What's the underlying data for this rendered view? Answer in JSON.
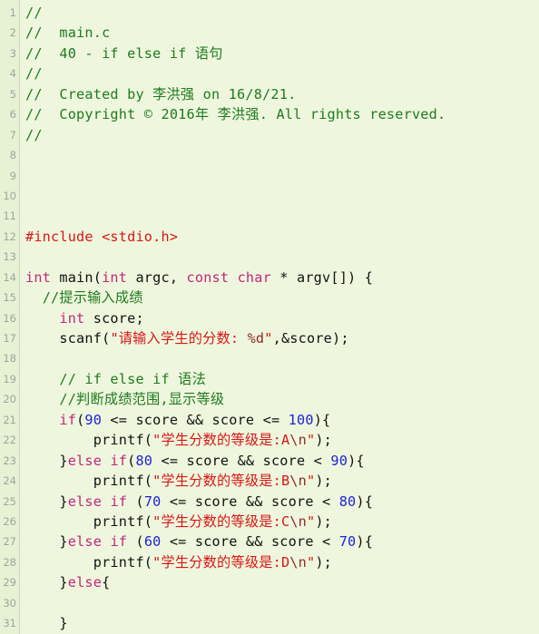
{
  "editor": {
    "name": "source-code-editor",
    "language": "c",
    "file_name": "main.c",
    "background_color": "#eef7dd",
    "gutter_color": "#e7f2d5",
    "colors": {
      "comment": "#1f7a1f",
      "keyword": "#c4267c",
      "number": "#1c23d6",
      "string": "#d81616",
      "escape": "#8f2a2a",
      "plain": "#111111",
      "line_number": "#9aa79a"
    },
    "first_visible_line": 1,
    "last_visible_line": 31
  },
  "line_numbers": [
    "1",
    "2",
    "3",
    "4",
    "5",
    "6",
    "7",
    "8",
    "9",
    "10",
    "11",
    "12",
    "13",
    "14",
    "15",
    "16",
    "17",
    "18",
    "19",
    "20",
    "21",
    "22",
    "23",
    "24",
    "25",
    "26",
    "27",
    "28",
    "29",
    "30",
    "31"
  ],
  "lines": [
    {
      "n": 1,
      "text": "//"
    },
    {
      "n": 2,
      "text": "//  main.c"
    },
    {
      "n": 3,
      "text": "//  40 - if else if 语句"
    },
    {
      "n": 4,
      "text": "//"
    },
    {
      "n": 5,
      "text": "//  Created by 李洪强 on 16/8/21."
    },
    {
      "n": 6,
      "text": "//  Copyright © 2016年 李洪强. All rights reserved."
    },
    {
      "n": 7,
      "text": "//"
    },
    {
      "n": 8,
      "text": ""
    },
    {
      "n": 9,
      "text": ""
    },
    {
      "n": 10,
      "text": ""
    },
    {
      "n": 11,
      "text": ""
    },
    {
      "n": 12,
      "text": "#include <stdio.h>"
    },
    {
      "n": 13,
      "text": ""
    },
    {
      "n": 14,
      "text": "int main(int argc, const char * argv[]) {"
    },
    {
      "n": 15,
      "text": "  //提示输入成绩"
    },
    {
      "n": 16,
      "text": "    int score;"
    },
    {
      "n": 17,
      "text": "    scanf(\"请输入学生的分数: %d\",&score);"
    },
    {
      "n": 18,
      "text": ""
    },
    {
      "n": 19,
      "text": "    // if else if 语法"
    },
    {
      "n": 20,
      "text": "    //判断成绩范围,显示等级"
    },
    {
      "n": 21,
      "text": "    if(90 <= score && score <= 100){"
    },
    {
      "n": 22,
      "text": "        printf(\"学生分数的等级是:A\\n\");"
    },
    {
      "n": 23,
      "text": "    }else if(80 <= score && score < 90){"
    },
    {
      "n": 24,
      "text": "        printf(\"学生分数的等级是:B\\n\");"
    },
    {
      "n": 25,
      "text": "    }else if (70 <= score && score < 80){"
    },
    {
      "n": 26,
      "text": "        printf(\"学生分数的等级是:C\\n\");"
    },
    {
      "n": 27,
      "text": "    }else if (60 <= score && score < 70){"
    },
    {
      "n": 28,
      "text": "        printf(\"学生分数的等级是:D\\n\");"
    },
    {
      "n": 29,
      "text": "    }else{"
    },
    {
      "n": 30,
      "text": ""
    },
    {
      "n": 31,
      "text": "    }"
    }
  ],
  "tokens": [
    [
      {
        "c": "t-cmt",
        "v": "//"
      }
    ],
    [
      {
        "c": "t-cmt",
        "v": "//  main.c"
      }
    ],
    [
      {
        "c": "t-cmt",
        "v": "//  40 - if else if 语句"
      }
    ],
    [
      {
        "c": "t-cmt",
        "v": "//"
      }
    ],
    [
      {
        "c": "t-cmt",
        "v": "//  Created by 李洪强 on 16/8/21."
      }
    ],
    [
      {
        "c": "t-cmt",
        "v": "//  Copyright © 2016年 李洪强. All rights reserved."
      }
    ],
    [
      {
        "c": "t-cmt",
        "v": "//"
      }
    ],
    [],
    [],
    [],
    [],
    [
      {
        "c": "t-pre",
        "v": "#include"
      },
      {
        "c": "t-pln",
        "v": " "
      },
      {
        "c": "t-pre",
        "v": "<stdio.h>"
      }
    ],
    [],
    [
      {
        "c": "t-kw",
        "v": "int"
      },
      {
        "c": "t-pln",
        "v": " main("
      },
      {
        "c": "t-kw",
        "v": "int"
      },
      {
        "c": "t-pln",
        "v": " argc, "
      },
      {
        "c": "t-kw",
        "v": "const"
      },
      {
        "c": "t-pln",
        "v": " "
      },
      {
        "c": "t-kw",
        "v": "char"
      },
      {
        "c": "t-pln",
        "v": " * argv[]) {"
      }
    ],
    [
      {
        "c": "t-pln",
        "v": "  "
      },
      {
        "c": "t-cmt",
        "v": "//提示输入成绩"
      }
    ],
    [
      {
        "c": "t-pln",
        "v": "    "
      },
      {
        "c": "t-kw",
        "v": "int"
      },
      {
        "c": "t-pln",
        "v": " score;"
      }
    ],
    [
      {
        "c": "t-pln",
        "v": "    scanf("
      },
      {
        "c": "t-str",
        "v": "\"请输入学生的分数: "
      },
      {
        "c": "t-esc",
        "v": "%d"
      },
      {
        "c": "t-str",
        "v": "\""
      },
      {
        "c": "t-pln",
        "v": ",&score);"
      }
    ],
    [],
    [
      {
        "c": "t-pln",
        "v": "    "
      },
      {
        "c": "t-cmt",
        "v": "// if else if 语法"
      }
    ],
    [
      {
        "c": "t-pln",
        "v": "    "
      },
      {
        "c": "t-cmt",
        "v": "//判断成绩范围,显示等级"
      }
    ],
    [
      {
        "c": "t-pln",
        "v": "    "
      },
      {
        "c": "t-kw",
        "v": "if"
      },
      {
        "c": "t-pln",
        "v": "("
      },
      {
        "c": "t-num",
        "v": "90"
      },
      {
        "c": "t-pln",
        "v": " <= score && score <= "
      },
      {
        "c": "t-num",
        "v": "100"
      },
      {
        "c": "t-pln",
        "v": "){"
      }
    ],
    [
      {
        "c": "t-pln",
        "v": "        printf("
      },
      {
        "c": "t-str",
        "v": "\"学生分数的等级是:A"
      },
      {
        "c": "t-esc",
        "v": "\\n"
      },
      {
        "c": "t-str",
        "v": "\""
      },
      {
        "c": "t-pln",
        "v": ");"
      }
    ],
    [
      {
        "c": "t-pln",
        "v": "    }"
      },
      {
        "c": "t-kw",
        "v": "else"
      },
      {
        "c": "t-pln",
        "v": " "
      },
      {
        "c": "t-kw",
        "v": "if"
      },
      {
        "c": "t-pln",
        "v": "("
      },
      {
        "c": "t-num",
        "v": "80"
      },
      {
        "c": "t-pln",
        "v": " <= score && score < "
      },
      {
        "c": "t-num",
        "v": "90"
      },
      {
        "c": "t-pln",
        "v": "){"
      }
    ],
    [
      {
        "c": "t-pln",
        "v": "        printf("
      },
      {
        "c": "t-str",
        "v": "\"学生分数的等级是:B"
      },
      {
        "c": "t-esc",
        "v": "\\n"
      },
      {
        "c": "t-str",
        "v": "\""
      },
      {
        "c": "t-pln",
        "v": ");"
      }
    ],
    [
      {
        "c": "t-pln",
        "v": "    }"
      },
      {
        "c": "t-kw",
        "v": "else"
      },
      {
        "c": "t-pln",
        "v": " "
      },
      {
        "c": "t-kw",
        "v": "if"
      },
      {
        "c": "t-pln",
        "v": " ("
      },
      {
        "c": "t-num",
        "v": "70"
      },
      {
        "c": "t-pln",
        "v": " <= score && score < "
      },
      {
        "c": "t-num",
        "v": "80"
      },
      {
        "c": "t-pln",
        "v": "){"
      }
    ],
    [
      {
        "c": "t-pln",
        "v": "        printf("
      },
      {
        "c": "t-str",
        "v": "\"学生分数的等级是:C"
      },
      {
        "c": "t-esc",
        "v": "\\n"
      },
      {
        "c": "t-str",
        "v": "\""
      },
      {
        "c": "t-pln",
        "v": ");"
      }
    ],
    [
      {
        "c": "t-pln",
        "v": "    }"
      },
      {
        "c": "t-kw",
        "v": "else"
      },
      {
        "c": "t-pln",
        "v": " "
      },
      {
        "c": "t-kw",
        "v": "if"
      },
      {
        "c": "t-pln",
        "v": " ("
      },
      {
        "c": "t-num",
        "v": "60"
      },
      {
        "c": "t-pln",
        "v": " <= score && score < "
      },
      {
        "c": "t-num",
        "v": "70"
      },
      {
        "c": "t-pln",
        "v": "){"
      }
    ],
    [
      {
        "c": "t-pln",
        "v": "        printf("
      },
      {
        "c": "t-str",
        "v": "\"学生分数的等级是:D"
      },
      {
        "c": "t-esc",
        "v": "\\n"
      },
      {
        "c": "t-str",
        "v": "\""
      },
      {
        "c": "t-pln",
        "v": ");"
      }
    ],
    [
      {
        "c": "t-pln",
        "v": "    }"
      },
      {
        "c": "t-kw",
        "v": "else"
      },
      {
        "c": "t-pln",
        "v": "{"
      }
    ],
    [],
    [
      {
        "c": "t-pln",
        "v": "    }"
      }
    ]
  ]
}
